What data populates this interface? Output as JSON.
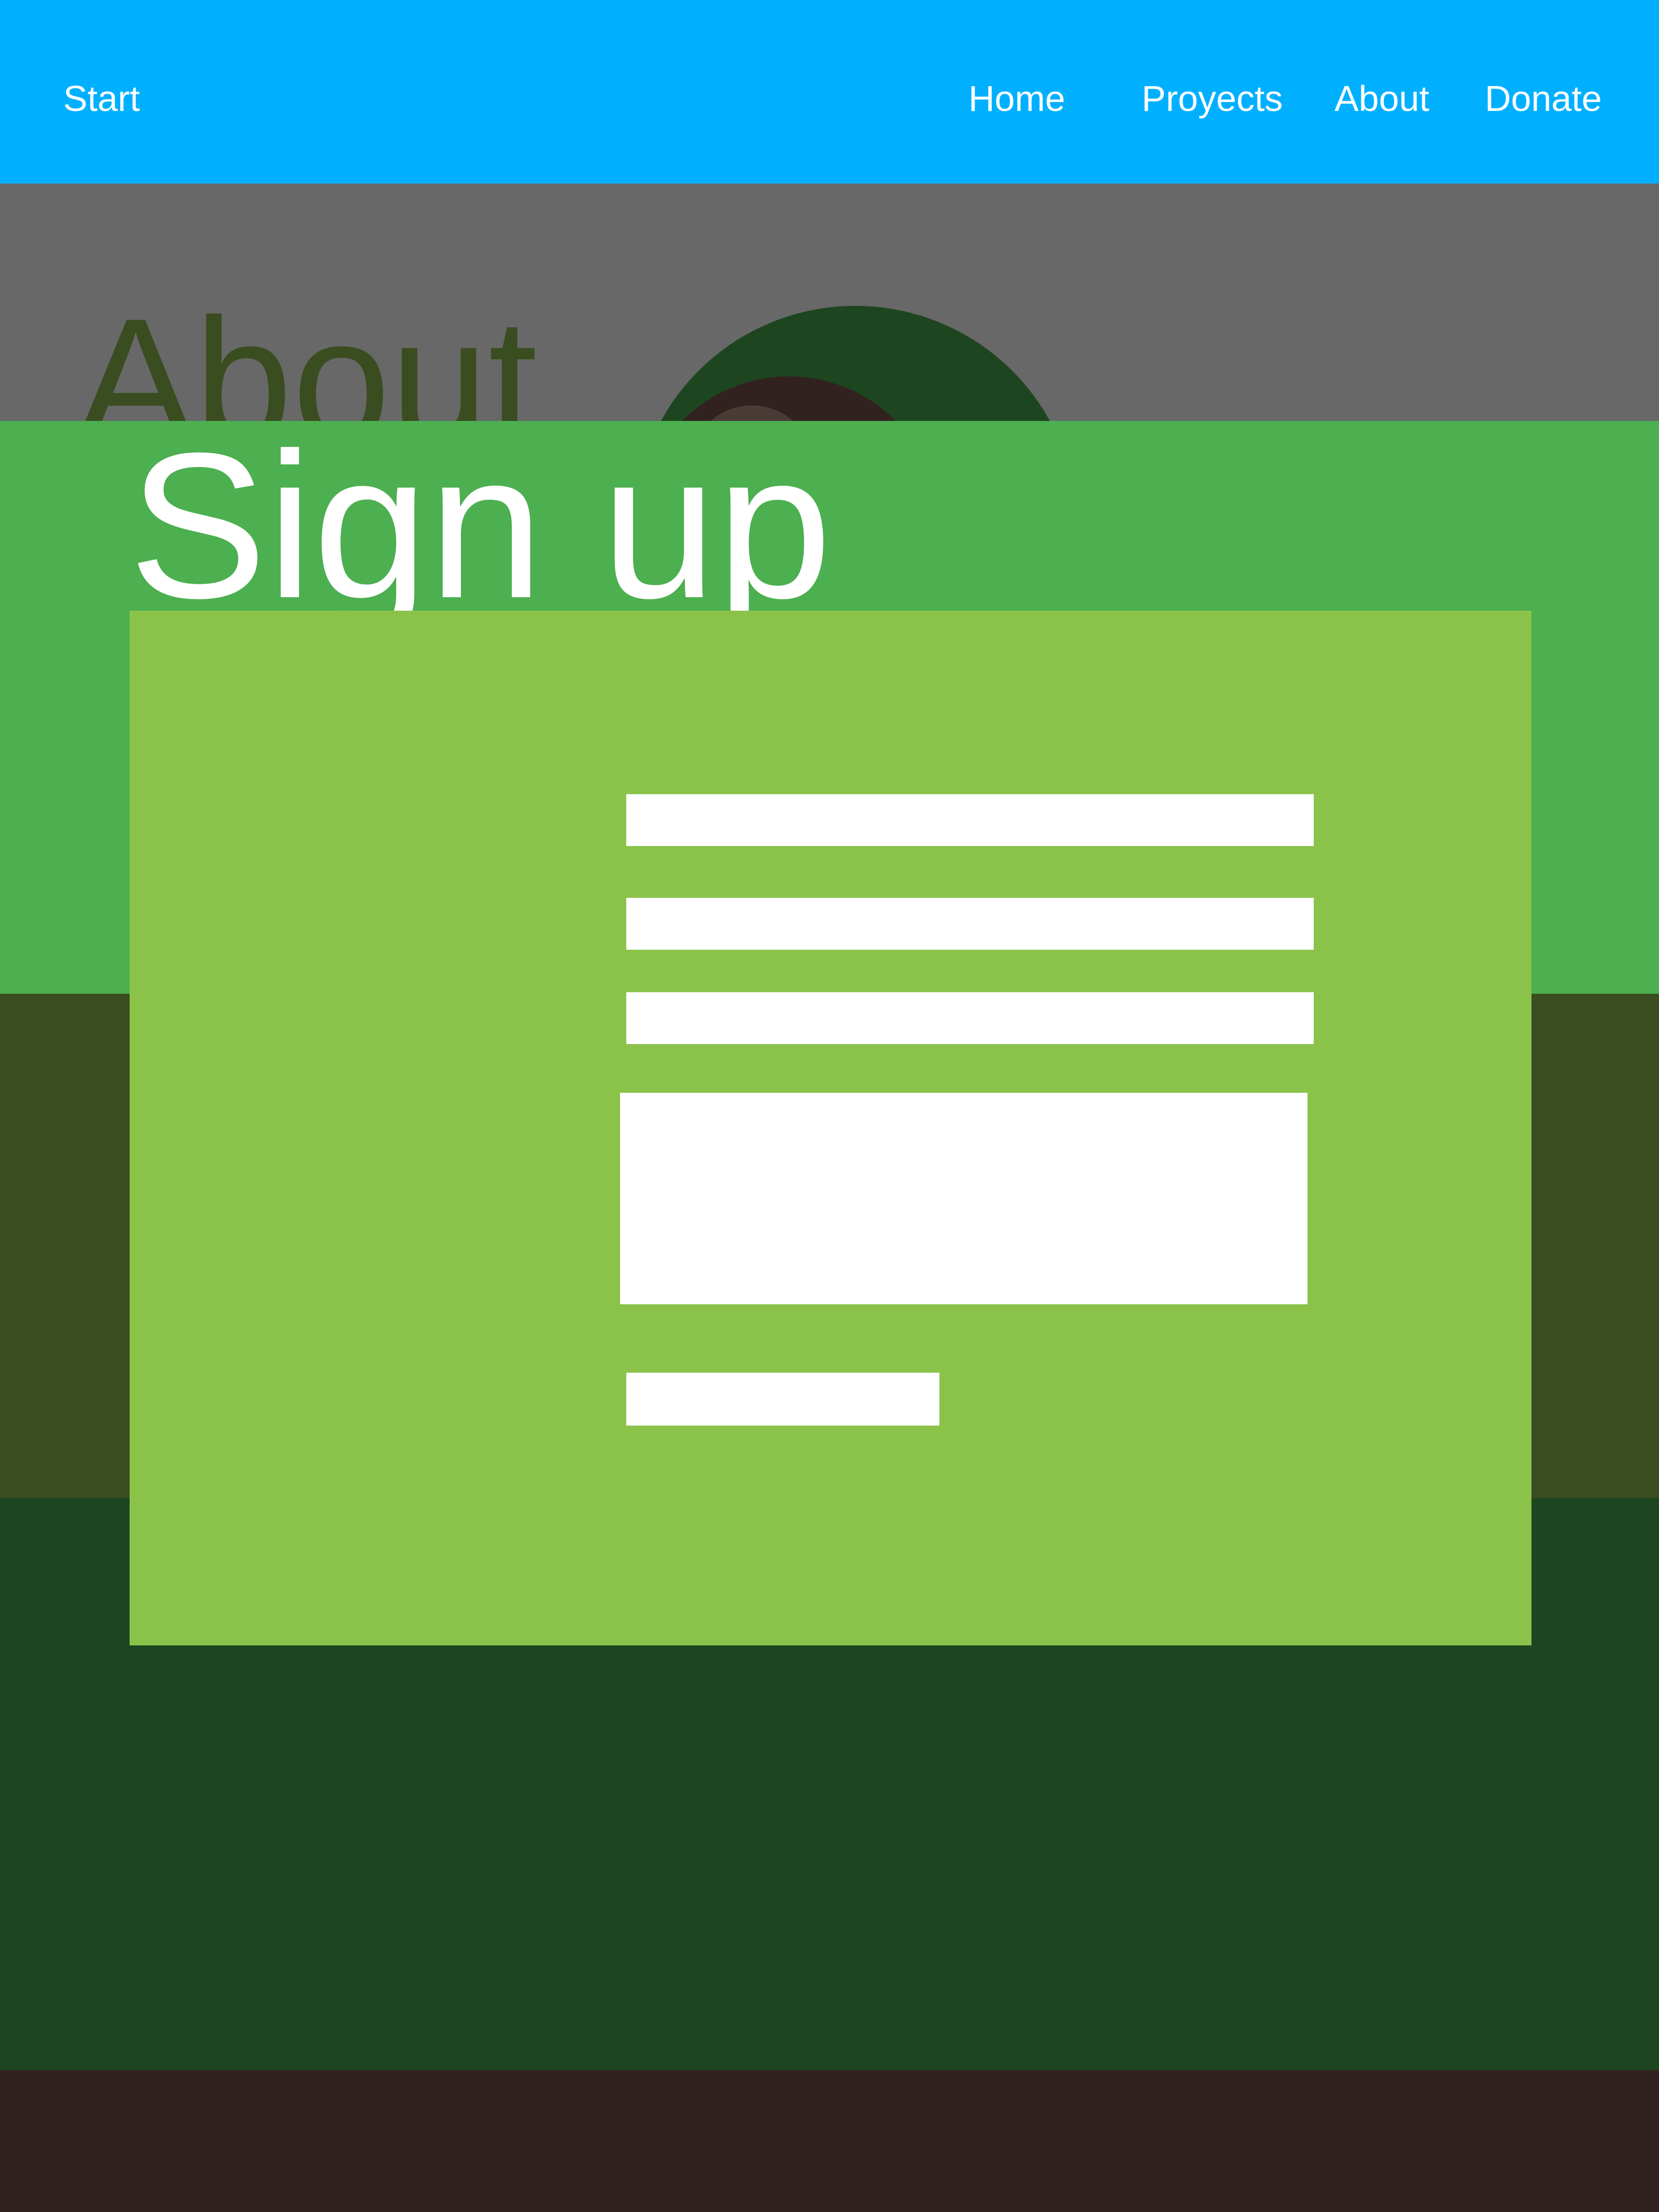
{
  "nav": {
    "brand": "Start",
    "links": [
      "Home",
      "Proyects",
      "About",
      "Donate"
    ]
  },
  "about": {
    "heading": "About"
  },
  "signup": {
    "heading": "Sign up",
    "fields": [
      {
        "value": "",
        "placeholder": ""
      },
      {
        "value": "",
        "placeholder": ""
      },
      {
        "value": "",
        "placeholder": ""
      }
    ],
    "message": {
      "value": "",
      "placeholder": ""
    },
    "submit_label": ""
  },
  "colors": {
    "navbar": "#00b0ff",
    "about_band": "#686868",
    "signup_band": "#4caf50",
    "signup_card": "#8bc34a",
    "olive_band": "#3a4d20",
    "dark_green_band": "#1d4620",
    "footer": "#312220",
    "text_light": "#ffffff"
  }
}
